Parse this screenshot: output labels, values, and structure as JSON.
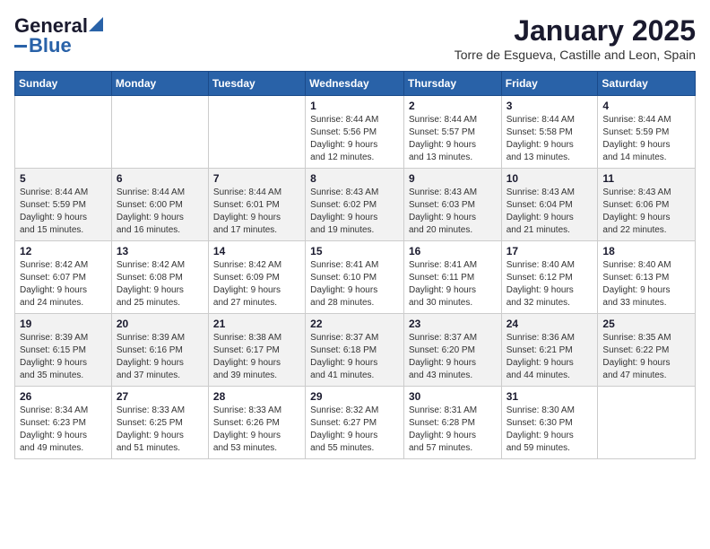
{
  "logo": {
    "line1": "General",
    "line2": "Blue"
  },
  "header": {
    "title": "January 2025",
    "subtitle": "Torre de Esgueva, Castille and Leon, Spain"
  },
  "weekdays": [
    "Sunday",
    "Monday",
    "Tuesday",
    "Wednesday",
    "Thursday",
    "Friday",
    "Saturday"
  ],
  "weeks": [
    [
      {
        "day": "",
        "info": ""
      },
      {
        "day": "",
        "info": ""
      },
      {
        "day": "",
        "info": ""
      },
      {
        "day": "1",
        "info": "Sunrise: 8:44 AM\nSunset: 5:56 PM\nDaylight: 9 hours\nand 12 minutes."
      },
      {
        "day": "2",
        "info": "Sunrise: 8:44 AM\nSunset: 5:57 PM\nDaylight: 9 hours\nand 13 minutes."
      },
      {
        "day": "3",
        "info": "Sunrise: 8:44 AM\nSunset: 5:58 PM\nDaylight: 9 hours\nand 13 minutes."
      },
      {
        "day": "4",
        "info": "Sunrise: 8:44 AM\nSunset: 5:59 PM\nDaylight: 9 hours\nand 14 minutes."
      }
    ],
    [
      {
        "day": "5",
        "info": "Sunrise: 8:44 AM\nSunset: 5:59 PM\nDaylight: 9 hours\nand 15 minutes."
      },
      {
        "day": "6",
        "info": "Sunrise: 8:44 AM\nSunset: 6:00 PM\nDaylight: 9 hours\nand 16 minutes."
      },
      {
        "day": "7",
        "info": "Sunrise: 8:44 AM\nSunset: 6:01 PM\nDaylight: 9 hours\nand 17 minutes."
      },
      {
        "day": "8",
        "info": "Sunrise: 8:43 AM\nSunset: 6:02 PM\nDaylight: 9 hours\nand 19 minutes."
      },
      {
        "day": "9",
        "info": "Sunrise: 8:43 AM\nSunset: 6:03 PM\nDaylight: 9 hours\nand 20 minutes."
      },
      {
        "day": "10",
        "info": "Sunrise: 8:43 AM\nSunset: 6:04 PM\nDaylight: 9 hours\nand 21 minutes."
      },
      {
        "day": "11",
        "info": "Sunrise: 8:43 AM\nSunset: 6:06 PM\nDaylight: 9 hours\nand 22 minutes."
      }
    ],
    [
      {
        "day": "12",
        "info": "Sunrise: 8:42 AM\nSunset: 6:07 PM\nDaylight: 9 hours\nand 24 minutes."
      },
      {
        "day": "13",
        "info": "Sunrise: 8:42 AM\nSunset: 6:08 PM\nDaylight: 9 hours\nand 25 minutes."
      },
      {
        "day": "14",
        "info": "Sunrise: 8:42 AM\nSunset: 6:09 PM\nDaylight: 9 hours\nand 27 minutes."
      },
      {
        "day": "15",
        "info": "Sunrise: 8:41 AM\nSunset: 6:10 PM\nDaylight: 9 hours\nand 28 minutes."
      },
      {
        "day": "16",
        "info": "Sunrise: 8:41 AM\nSunset: 6:11 PM\nDaylight: 9 hours\nand 30 minutes."
      },
      {
        "day": "17",
        "info": "Sunrise: 8:40 AM\nSunset: 6:12 PM\nDaylight: 9 hours\nand 32 minutes."
      },
      {
        "day": "18",
        "info": "Sunrise: 8:40 AM\nSunset: 6:13 PM\nDaylight: 9 hours\nand 33 minutes."
      }
    ],
    [
      {
        "day": "19",
        "info": "Sunrise: 8:39 AM\nSunset: 6:15 PM\nDaylight: 9 hours\nand 35 minutes."
      },
      {
        "day": "20",
        "info": "Sunrise: 8:39 AM\nSunset: 6:16 PM\nDaylight: 9 hours\nand 37 minutes."
      },
      {
        "day": "21",
        "info": "Sunrise: 8:38 AM\nSunset: 6:17 PM\nDaylight: 9 hours\nand 39 minutes."
      },
      {
        "day": "22",
        "info": "Sunrise: 8:37 AM\nSunset: 6:18 PM\nDaylight: 9 hours\nand 41 minutes."
      },
      {
        "day": "23",
        "info": "Sunrise: 8:37 AM\nSunset: 6:20 PM\nDaylight: 9 hours\nand 43 minutes."
      },
      {
        "day": "24",
        "info": "Sunrise: 8:36 AM\nSunset: 6:21 PM\nDaylight: 9 hours\nand 44 minutes."
      },
      {
        "day": "25",
        "info": "Sunrise: 8:35 AM\nSunset: 6:22 PM\nDaylight: 9 hours\nand 47 minutes."
      }
    ],
    [
      {
        "day": "26",
        "info": "Sunrise: 8:34 AM\nSunset: 6:23 PM\nDaylight: 9 hours\nand 49 minutes."
      },
      {
        "day": "27",
        "info": "Sunrise: 8:33 AM\nSunset: 6:25 PM\nDaylight: 9 hours\nand 51 minutes."
      },
      {
        "day": "28",
        "info": "Sunrise: 8:33 AM\nSunset: 6:26 PM\nDaylight: 9 hours\nand 53 minutes."
      },
      {
        "day": "29",
        "info": "Sunrise: 8:32 AM\nSunset: 6:27 PM\nDaylight: 9 hours\nand 55 minutes."
      },
      {
        "day": "30",
        "info": "Sunrise: 8:31 AM\nSunset: 6:28 PM\nDaylight: 9 hours\nand 57 minutes."
      },
      {
        "day": "31",
        "info": "Sunrise: 8:30 AM\nSunset: 6:30 PM\nDaylight: 9 hours\nand 59 minutes."
      },
      {
        "day": "",
        "info": ""
      }
    ]
  ]
}
